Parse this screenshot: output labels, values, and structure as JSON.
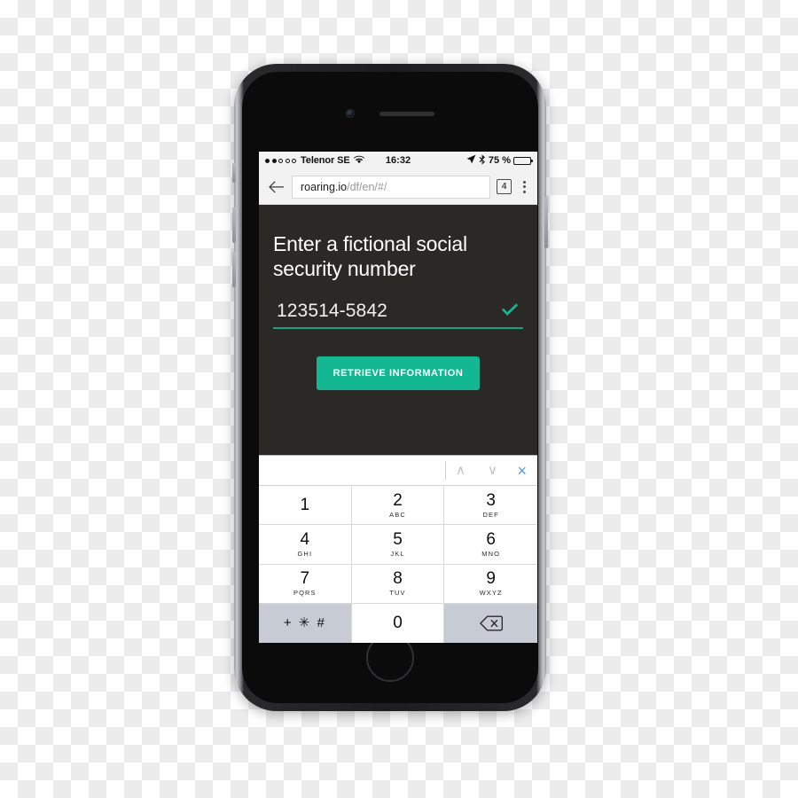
{
  "device": {
    "name": "iphone-mockup",
    "frame_color": "#1d1d1f",
    "bezel_color": "#0b0b0c"
  },
  "status_bar": {
    "signal_dots_filled": 2,
    "signal_dots_total": 5,
    "carrier": "Telenor SE",
    "wifi_icon": "wifi-icon",
    "time": "16:32",
    "location_icon": "location-arrow-icon",
    "bluetooth_icon": "bluetooth-icon",
    "battery_percent": "75 %",
    "battery_level": 75
  },
  "browser": {
    "back_icon": "back-arrow-icon",
    "url_host": "roaring.io",
    "url_path": "/df/en/#/",
    "url_full": "roaring.io/df/en/#/",
    "tab_count": "4",
    "menu_icon": "overflow-menu-icon"
  },
  "page": {
    "background_color": "#2b2926",
    "heading": "Enter a fictional social security number",
    "ssn_value": "123514-5842",
    "ssn_valid_icon": "checkmark-icon",
    "ssn_valid_color": "#16b394",
    "underline_color": "#16a085",
    "button_label": "RETRIEVE INFORMATION",
    "button_color": "#13b792"
  },
  "keyboard": {
    "toolbar": {
      "prev_icon": "chevron-up-icon",
      "prev_label": "∧",
      "next_icon": "chevron-down-icon",
      "next_label": "∨",
      "close_icon": "close-icon",
      "close_label": "×",
      "close_color": "#4a9cf0"
    },
    "keys": [
      {
        "num": "1",
        "letters": "",
        "name": "key-1",
        "style": "white"
      },
      {
        "num": "2",
        "letters": "ABC",
        "name": "key-2",
        "style": "white"
      },
      {
        "num": "3",
        "letters": "DEF",
        "name": "key-3",
        "style": "white"
      },
      {
        "num": "4",
        "letters": "GHI",
        "name": "key-4",
        "style": "white"
      },
      {
        "num": "5",
        "letters": "JKL",
        "name": "key-5",
        "style": "white"
      },
      {
        "num": "6",
        "letters": "MNO",
        "name": "key-6",
        "style": "white"
      },
      {
        "num": "7",
        "letters": "PQRS",
        "name": "key-7",
        "style": "white"
      },
      {
        "num": "8",
        "letters": "TUV",
        "name": "key-8",
        "style": "white"
      },
      {
        "num": "9",
        "letters": "WXYZ",
        "name": "key-9",
        "style": "white"
      },
      {
        "num": "+ ✳ #",
        "letters": "",
        "name": "key-symbols",
        "style": "grey"
      },
      {
        "num": "0",
        "letters": "",
        "name": "key-0",
        "style": "white"
      },
      {
        "num": "",
        "letters": "",
        "name": "key-backspace",
        "style": "grey"
      }
    ],
    "grey_key_color": "#c6cbd4",
    "backspace_icon": "backspace-icon"
  }
}
